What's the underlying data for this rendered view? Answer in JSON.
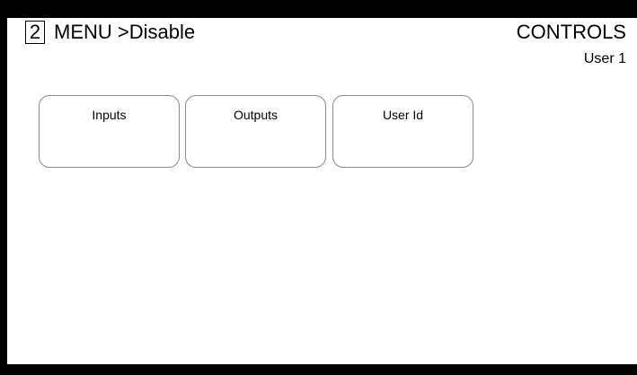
{
  "header": {
    "level": "2",
    "breadcrumb": "MENU >Disable",
    "section": "CONTROLS",
    "user": "User 1"
  },
  "menu": {
    "buttons": [
      {
        "label": "Inputs"
      },
      {
        "label": "Outputs"
      },
      {
        "label": "User Id"
      }
    ]
  }
}
